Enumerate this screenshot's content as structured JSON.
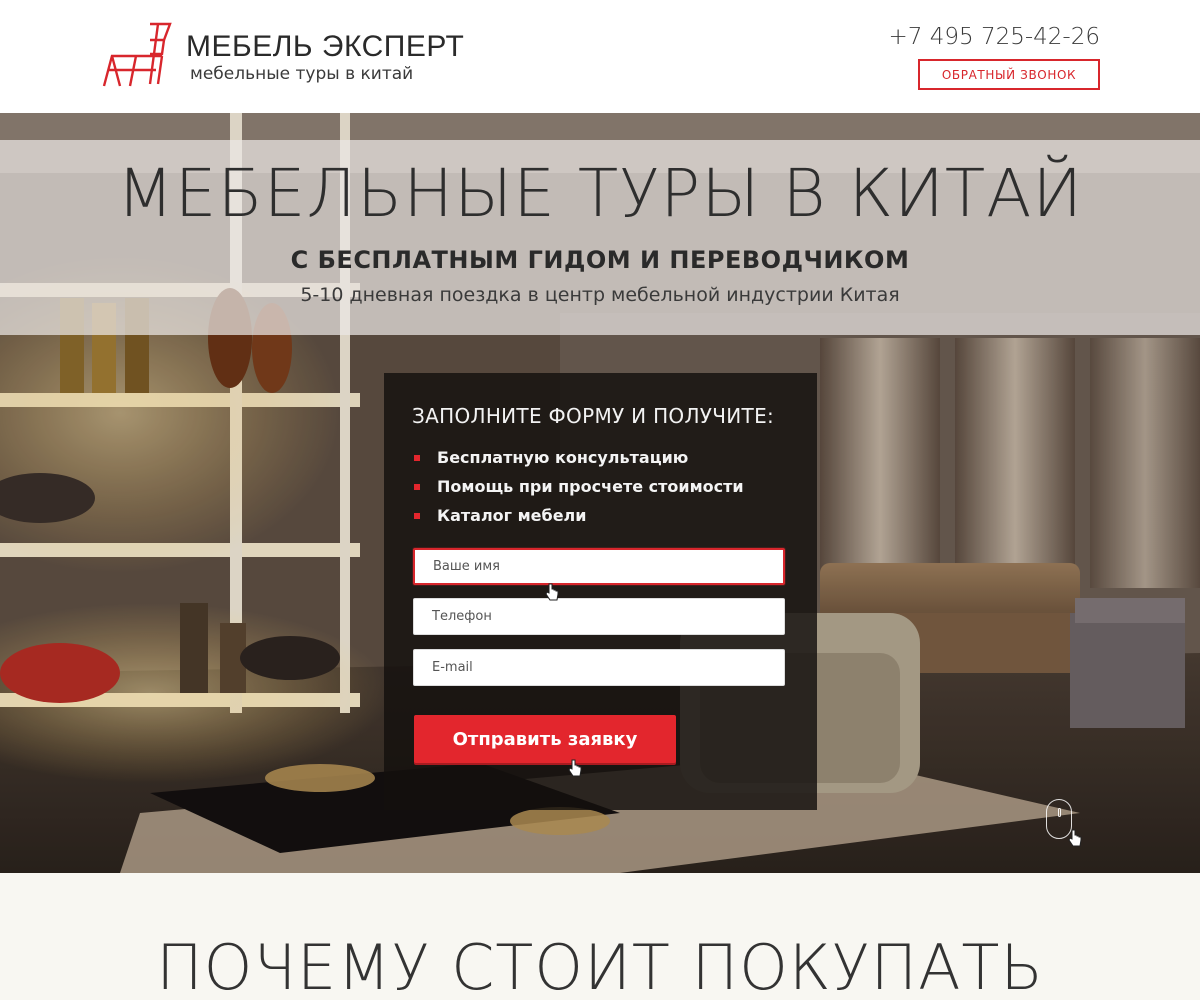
{
  "header": {
    "logo_title": "МЕБЕЛЬ ЭКСПЕРТ",
    "logo_subtitle": "мебельные туры в китай",
    "phone": "+7 495 725-42-26",
    "callback_label": "ОБРАТНЫЙ ЗВОНОК"
  },
  "hero": {
    "title": "МЕБЕЛЬНЫЕ ТУРЫ В КИТАЙ",
    "subtitle": "С БЕСПЛАТНЫМ ГИДОМ И ПЕРЕВОДЧИКОМ",
    "description": "5-10 дневная поездка в центр мебельной индустрии Китая"
  },
  "form": {
    "heading": "ЗАПОЛНИТЕ ФОРМУ И ПОЛУЧИТЕ:",
    "benefits": [
      "Бесплатную консультацию",
      "Помощь при просчете стоимости",
      "Каталог мебели"
    ],
    "name_placeholder": "Ваше имя",
    "phone_placeholder": "Телефон",
    "email_placeholder": "E-mail",
    "submit_label": "Отправить заявку"
  },
  "why": {
    "title": "ПОЧЕМУ СТОИТ ПОКУПАТЬ"
  },
  "colors": {
    "accent": "#e3262d",
    "text_dark": "#2e2e2e"
  },
  "icons": {
    "logo": "chair-logo-icon",
    "scroll": "mouse-scroll-icon",
    "cursor": "hand-cursor-icon"
  }
}
